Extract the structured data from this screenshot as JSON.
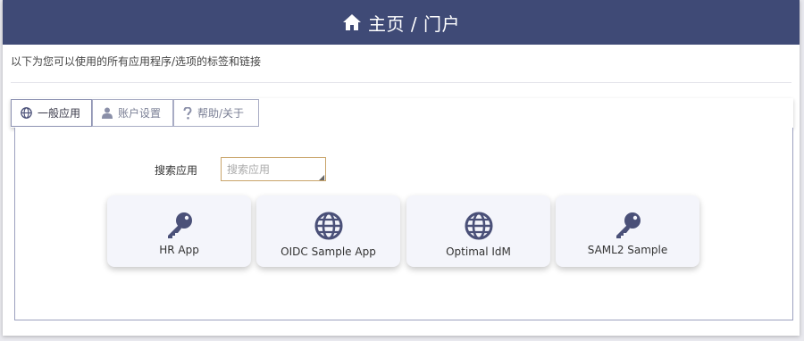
{
  "header": {
    "title": "主页 / 门户",
    "icon": "home-icon"
  },
  "description": "以下为您可以使用的所有应用程序/选项的标签和链接",
  "tabs": [
    {
      "label": "一般应用",
      "icon": "globe-icon",
      "active": true
    },
    {
      "label": "账户设置",
      "icon": "user-icon",
      "active": false
    },
    {
      "label": "帮助/关于",
      "icon": "question-icon",
      "active": false
    }
  ],
  "search": {
    "label": "搜索应用",
    "placeholder": "搜索应用",
    "value": ""
  },
  "apps": [
    {
      "name": "HR App",
      "icon": "key-icon"
    },
    {
      "name": "OIDC Sample App",
      "icon": "globe-icon"
    },
    {
      "name": "Optimal IdM",
      "icon": "globe-icon"
    },
    {
      "name": "SAML2 Sample",
      "icon": "key-icon"
    }
  ],
  "colors": {
    "header_bg": "#3f4a76",
    "icon": "#4a5078",
    "card_bg": "#f4f5fb",
    "input_border": "#c9a46a"
  }
}
